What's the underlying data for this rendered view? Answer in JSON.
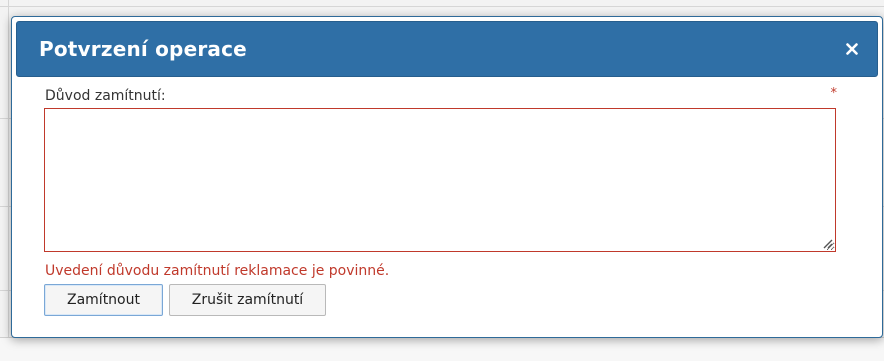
{
  "dialog": {
    "title": "Potvrzení operace",
    "close_icon": "close-icon",
    "field": {
      "label": "Důvod zamítnutí:",
      "required_marker": "*",
      "value": "",
      "placeholder": ""
    },
    "error_message": "Uvedení důvodu zamítnutí reklamace je povinné.",
    "buttons": {
      "confirm_label": "Zamítnout",
      "cancel_label": "Zrušit zamítnutí"
    }
  },
  "colors": {
    "header_bg": "#2f6fa6",
    "error": "#c0392b"
  }
}
